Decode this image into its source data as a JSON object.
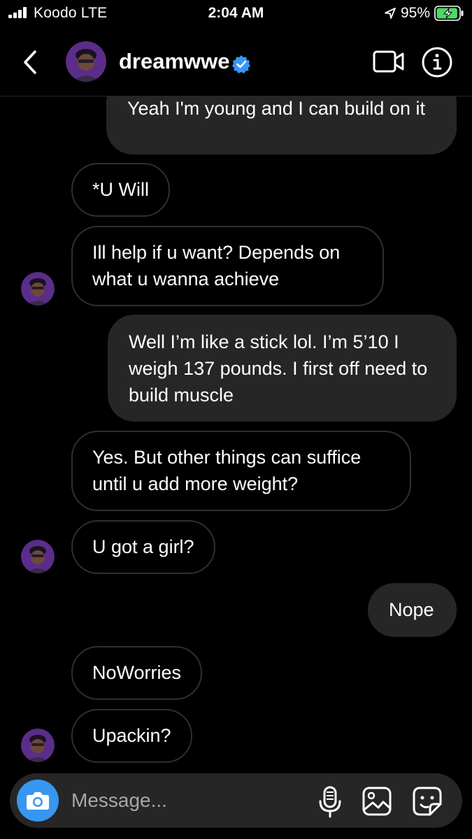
{
  "status_bar": {
    "carrier": "Koodo  LTE",
    "time": "2:04 AM",
    "battery_percent": "95%",
    "battery_level": 0.95,
    "icons": [
      "signal-icon",
      "location-arrow-icon",
      "battery-charging-icon"
    ]
  },
  "header": {
    "username": "dreamwwe",
    "verified": true,
    "icons": [
      "back-chevron-icon",
      "verified-badge-icon",
      "video-call-icon",
      "info-icon"
    ]
  },
  "messages": [
    {
      "from": "me",
      "text": "Yeah I'm young and I can build on it"
    },
    {
      "from": "them",
      "text": "*U Will"
    },
    {
      "from": "them",
      "text": "Ill help if u want? Depends on what u wanna achieve"
    },
    {
      "from": "me",
      "text": "Well I’m like a stick lol. I’m 5’10 I weigh 137 pounds. I first off need to build muscle"
    },
    {
      "from": "them",
      "text": "Yes. But other things can suffice until u add more weight?"
    },
    {
      "from": "them",
      "text": "U got a girl?"
    },
    {
      "from": "me",
      "text": "Nope"
    },
    {
      "from": "them",
      "text": "NoWorries"
    },
    {
      "from": "them",
      "text": "Upackin?"
    }
  ],
  "composer": {
    "placeholder": "Message...",
    "icons": [
      "camera-icon",
      "microphone-icon",
      "gallery-icon",
      "sticker-icon"
    ]
  },
  "colors": {
    "background": "#000000",
    "outgoing_bubble": "#262626",
    "incoming_border": "#2f2f2f",
    "camera_button": "#3797f0",
    "verified_badge": "#3797f0",
    "battery_fill": "#4cd964"
  }
}
